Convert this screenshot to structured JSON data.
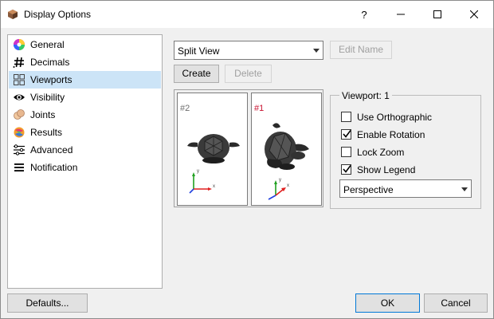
{
  "window": {
    "title": "Display Options"
  },
  "titlebar": {
    "help": "?",
    "minimize": "—",
    "maximize": "□",
    "close": "✕"
  },
  "nav": {
    "items": [
      {
        "label": "General",
        "icon": "color-wheel-icon"
      },
      {
        "label": "Decimals",
        "icon": "hash-icon"
      },
      {
        "label": "Viewports",
        "icon": "grid-icon"
      },
      {
        "label": "Visibility",
        "icon": "eye-icon"
      },
      {
        "label": "Joints",
        "icon": "joints-icon"
      },
      {
        "label": "Results",
        "icon": "results-icon"
      },
      {
        "label": "Advanced",
        "icon": "sliders-icon"
      },
      {
        "label": "Notification",
        "icon": "menu-icon"
      }
    ],
    "selected": "Viewports"
  },
  "layout_select": {
    "value": "Split View"
  },
  "buttons": {
    "edit_name": "Edit Name",
    "create": "Create",
    "delete": "Delete",
    "defaults": "Defaults...",
    "ok": "OK",
    "cancel": "Cancel"
  },
  "viewports": [
    {
      "label": "#2",
      "color": "#6d6d6d"
    },
    {
      "label": "#1",
      "color": "#c8102e"
    }
  ],
  "viewport_group": {
    "title": "Viewport: 1",
    "options": [
      {
        "label": "Use Orthographic",
        "checked": false
      },
      {
        "label": "Enable Rotation",
        "checked": true
      },
      {
        "label": "Lock Zoom",
        "checked": false
      },
      {
        "label": "Show Legend",
        "checked": true
      }
    ],
    "projection": "Perspective"
  },
  "axes": {
    "x": "x",
    "y": "y"
  },
  "colors": {
    "selection": "#cce4f7",
    "accent": "#0078d7",
    "axis_x": "#e02020",
    "axis_y": "#20a020",
    "axis_z": "#2040e0"
  }
}
